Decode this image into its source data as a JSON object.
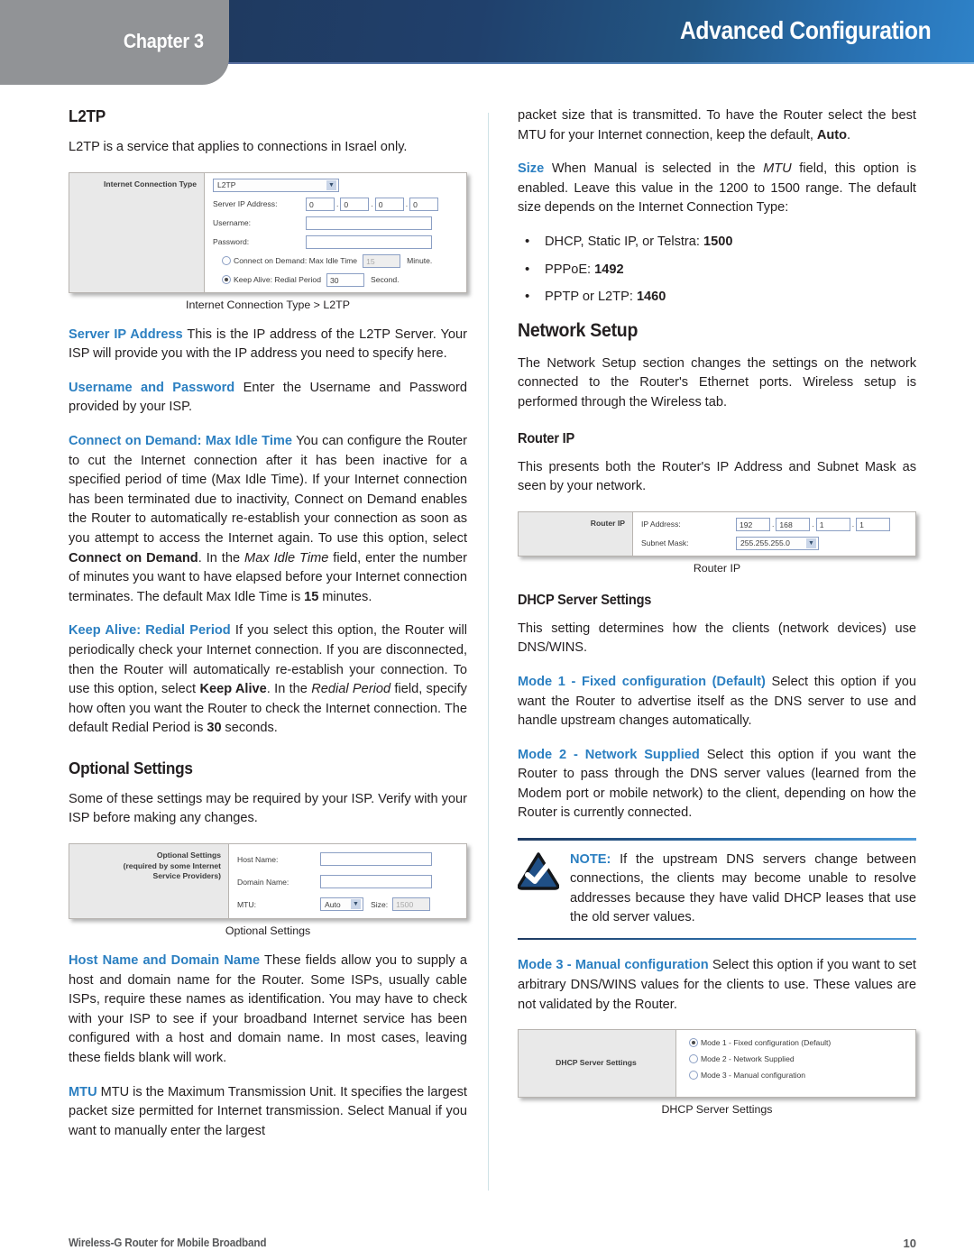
{
  "header": {
    "chapter_label": "Chapter 3",
    "title": "Advanced Configuration",
    "tab_color": "#919396",
    "banner_from": "#1f3a60",
    "banner_to": "#2e82c8"
  },
  "accent_color": "#2b7fc1",
  "left_column": {
    "l2tp_heading": "L2TP",
    "l2tp_intro": "L2TP is a service that applies to connections in Israel only.",
    "figure_l2tp": {
      "panel_label": "Internet Connection Type",
      "connection_type_value": "L2TP",
      "server_ip_label": "Server IP Address:",
      "server_ip_octets": [
        "0",
        "0",
        "0",
        "0"
      ],
      "username_label": "Username:",
      "username_value": "",
      "password_label": "Password:",
      "password_value": "",
      "connect_on_demand_label": "Connect on Demand: Max Idle Time",
      "connect_on_demand_value": "15",
      "connect_on_demand_unit": "Minute.",
      "connect_on_demand_selected": false,
      "keep_alive_label": "Keep Alive: Redial Period",
      "keep_alive_value": "30",
      "keep_alive_unit": "Second.",
      "keep_alive_selected": true,
      "caption": "Internet Connection Type > L2TP"
    },
    "p_server_ip_lead": "Server IP Address",
    "p_server_ip_text": " This is the IP address of the L2TP Server. Your ISP will provide you with the IP address you need to specify here.",
    "p_userpass_lead": "Username and Password",
    "p_userpass_text": " Enter the Username and Password provided by your ISP.",
    "p_cod_lead": "Connect on Demand: Max Idle Time",
    "p_cod_t1": "  You can configure the Router to cut the Internet connection after it has been inactive for a specified period of time (Max Idle Time). If your Internet connection has been terminated due to inactivity, Connect on Demand enables the Router to automatically re-establish your connection as soon as you attempt to access the Internet again. To use this option, select ",
    "p_cod_b1": "Connect on Demand",
    "p_cod_t2": ". In the ",
    "p_cod_i1": "Max Idle Time",
    "p_cod_t3": " field, enter the number of minutes you want to have elapsed before your Internet connection terminates. The default Max Idle Time is ",
    "p_cod_b2": "15",
    "p_cod_t4": " minutes.",
    "p_ka_lead": "Keep Alive: Redial Period",
    "p_ka_t1": "  If you select this option, the Router will periodically check your Internet connection. If you are disconnected, then the Router will automatically re-establish your connection. To use this option, select ",
    "p_ka_b1": "Keep Alive",
    "p_ka_t2": ". In the ",
    "p_ka_i1": "Redial Period",
    "p_ka_t3": " field, specify how often you want the Router to check the Internet connection. The default Redial Period is ",
    "p_ka_b2": "30",
    "p_ka_t4": " seconds.",
    "optional_settings_heading": "Optional Settings",
    "optional_settings_intro": "Some of these settings may be required by your ISP. Verify with your ISP before making any changes.",
    "figure_optional": {
      "panel_label_line1": "Optional Settings",
      "panel_label_line2": "(required by some Internet",
      "panel_label_line3": "Service Providers)",
      "host_name_label": "Host Name:",
      "host_name_value": "",
      "domain_name_label": "Domain Name:",
      "domain_name_value": "",
      "mtu_label": "MTU:",
      "mtu_value": "Auto",
      "size_label": "Size:",
      "size_value": "1500",
      "caption": "Optional Settings"
    },
    "p_hostname_lead": "Host Name and Domain Name",
    "p_hostname_text": "  These fields allow you to supply a host and domain name for the Router. Some ISPs, usually cable ISPs, require these names as identification. You may have to check with your ISP to see if your broadband Internet service has been configured with a host and domain name. In most cases, leaving these fields blank will work.",
    "p_mtu_lead": "MTU",
    "p_mtu_text": "  MTU is the Maximum Transmission Unit. It specifies the largest packet size permitted for Internet transmission. Select Manual if you want to manually enter the largest"
  },
  "right_column": {
    "p_cont_t1": "packet size that is transmitted. To have the Router select the best MTU for your Internet connection, keep the default, ",
    "p_cont_b1": "Auto",
    "p_cont_t2": ".",
    "p_size_lead": "Size",
    "p_size_t1": "  When Manual is selected in the ",
    "p_size_i1": "MTU",
    "p_size_t2": " field, this option is enabled. Leave this value in the 1200 to 1500 range. The default size depends on the Internet Connection Type:",
    "mtu_bullets": [
      {
        "text": "DHCP, Static IP, or Telstra: ",
        "value": "1500"
      },
      {
        "text": "PPPoE: ",
        "value": "1492"
      },
      {
        "text": "PPTP or L2TP: ",
        "value": "1460"
      }
    ],
    "network_setup_heading": "Network Setup",
    "network_setup_intro": "The Network Setup section changes the settings on the network connected to the Router's Ethernet ports. Wireless setup is performed through the Wireless tab.",
    "router_ip_heading": "Router IP",
    "router_ip_intro": "This presents both the Router's IP Address and Subnet Mask as seen by your network.",
    "figure_router_ip": {
      "panel_label": "Router IP",
      "ip_address_label": "IP Address:",
      "ip_octets": [
        "192",
        "168",
        "1",
        "1"
      ],
      "subnet_mask_label": "Subnet Mask:",
      "subnet_mask_value": "255.255.255.0",
      "caption": "Router IP"
    },
    "dhcp_heading": "DHCP Server Settings",
    "dhcp_intro": "This setting determines how the clients (network devices) use DNS/WINS.",
    "p_mode1_lead": "Mode 1 - Fixed configuration (Default)",
    "p_mode1_text": "  Select this option if you want the Router to advertise itself as the DNS server to use and handle upstream changes automatically.",
    "p_mode2_lead": "Mode 2 - Network Supplied",
    "p_mode2_text": "  Select this option if you want the Router to pass through the DNS server values (learned from the Modem port or mobile network) to the client, depending on how the Router is currently connected.",
    "note": {
      "icon": "check-badge-icon",
      "keyword": "NOTE:",
      "text": " If the upstream DNS servers change between connections, the clients may become unable to resolve addresses because they have valid DHCP leases that use the old server values."
    },
    "p_mode3_lead": "Mode 3 - Manual configuration",
    "p_mode3_text": "  Select this option if you want to set arbitrary DNS/WINS values for the clients to use. These values are not validated by the Router.",
    "figure_dhcp": {
      "panel_label": "DHCP Server Settings",
      "options": [
        {
          "label": "Mode 1 - Fixed configuration (Default)",
          "selected": true
        },
        {
          "label": "Mode 2 - Network Supplied",
          "selected": false
        },
        {
          "label": "Mode 3 - Manual configuration",
          "selected": false
        }
      ],
      "caption": "DHCP Server Settings"
    }
  },
  "footer": {
    "product": "Wireless-G Router for Mobile Broadband",
    "page_number": "10"
  }
}
